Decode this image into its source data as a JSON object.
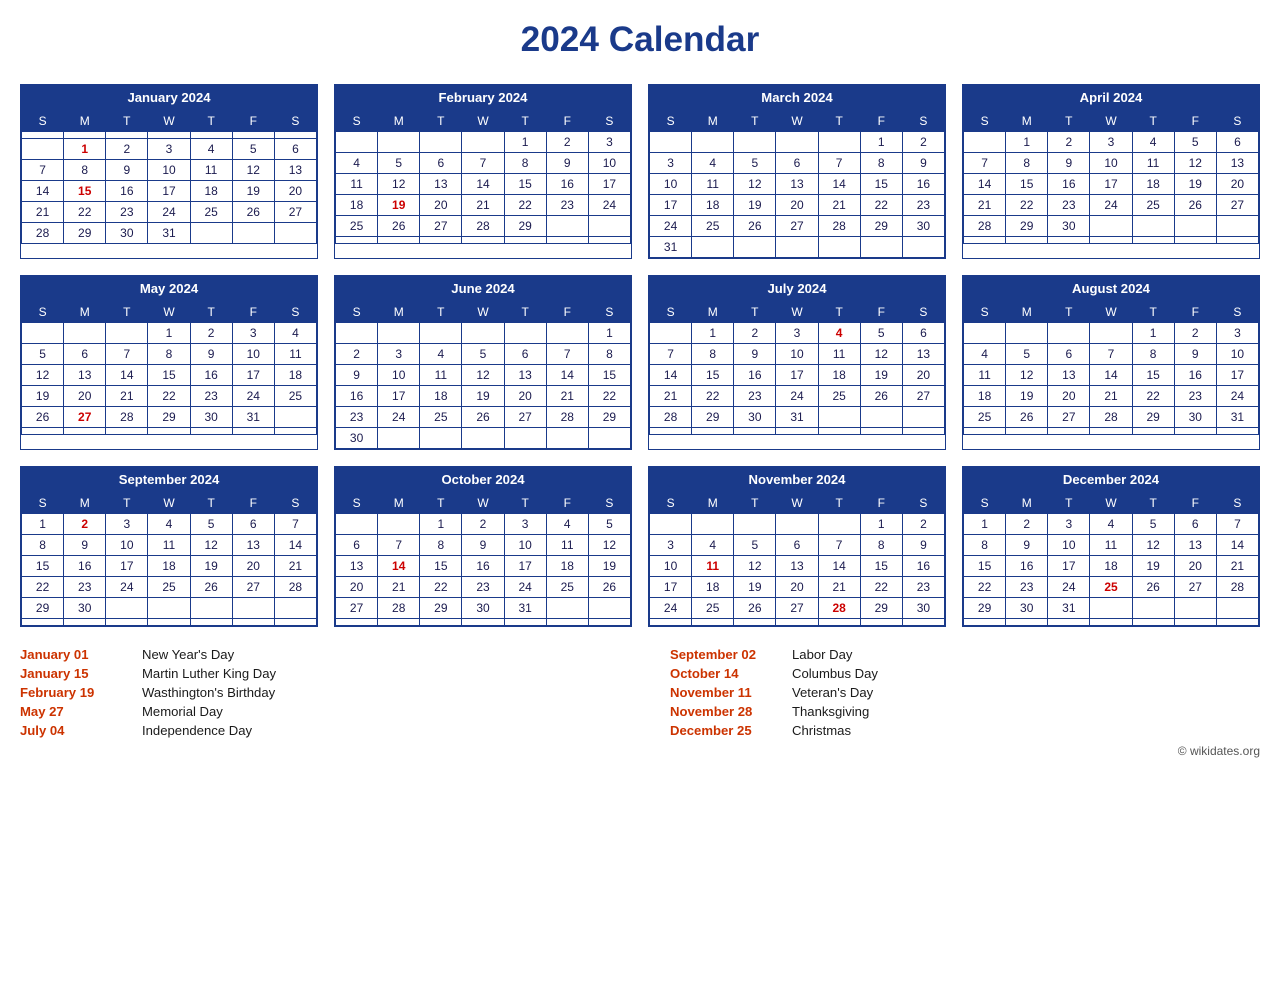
{
  "title": "2024 Calendar",
  "months": [
    {
      "name": "January 2024",
      "days": [
        [
          "",
          "",
          "",
          "",
          "",
          "",
          ""
        ],
        [
          "",
          "1",
          "2",
          "3",
          "4",
          "5",
          "6"
        ],
        [
          "7",
          "8",
          "9",
          "10",
          "11",
          "12",
          "13"
        ],
        [
          "14",
          "15",
          "16",
          "17",
          "18",
          "19",
          "20"
        ],
        [
          "21",
          "22",
          "23",
          "24",
          "25",
          "26",
          "27"
        ],
        [
          "28",
          "29",
          "30",
          "31",
          "",
          "",
          ""
        ]
      ],
      "holidays": [
        "1",
        "15"
      ]
    },
    {
      "name": "February 2024",
      "days": [
        [
          "",
          "",
          "",
          "",
          "1",
          "2",
          "3"
        ],
        [
          "4",
          "5",
          "6",
          "7",
          "8",
          "9",
          "10"
        ],
        [
          "11",
          "12",
          "13",
          "14",
          "15",
          "16",
          "17"
        ],
        [
          "18",
          "19",
          "20",
          "21",
          "22",
          "23",
          "24"
        ],
        [
          "25",
          "26",
          "27",
          "28",
          "29",
          "",
          ""
        ],
        [
          "",
          "",
          "",
          "",
          "",
          "",
          ""
        ]
      ],
      "holidays": [
        "19"
      ]
    },
    {
      "name": "March 2024",
      "days": [
        [
          "",
          "",
          "",
          "",
          "",
          "1",
          "2"
        ],
        [
          "3",
          "4",
          "5",
          "6",
          "7",
          "8",
          "9"
        ],
        [
          "10",
          "11",
          "12",
          "13",
          "14",
          "15",
          "16"
        ],
        [
          "17",
          "18",
          "19",
          "20",
          "21",
          "22",
          "23"
        ],
        [
          "24",
          "25",
          "26",
          "27",
          "28",
          "29",
          "30"
        ],
        [
          "31",
          "",
          "",
          "",
          "",
          "",
          ""
        ]
      ],
      "holidays": []
    },
    {
      "name": "April 2024",
      "days": [
        [
          "",
          "1",
          "2",
          "3",
          "4",
          "5",
          "6"
        ],
        [
          "7",
          "8",
          "9",
          "10",
          "11",
          "12",
          "13"
        ],
        [
          "14",
          "15",
          "16",
          "17",
          "18",
          "19",
          "20"
        ],
        [
          "21",
          "22",
          "23",
          "24",
          "25",
          "26",
          "27"
        ],
        [
          "28",
          "29",
          "30",
          "",
          "",
          "",
          ""
        ],
        [
          "",
          "",
          "",
          "",
          "",
          "",
          ""
        ]
      ],
      "holidays": []
    },
    {
      "name": "May 2024",
      "days": [
        [
          "",
          "",
          "",
          "1",
          "2",
          "3",
          "4"
        ],
        [
          "5",
          "6",
          "7",
          "8",
          "9",
          "10",
          "11"
        ],
        [
          "12",
          "13",
          "14",
          "15",
          "16",
          "17",
          "18"
        ],
        [
          "19",
          "20",
          "21",
          "22",
          "23",
          "24",
          "25"
        ],
        [
          "26",
          "27",
          "28",
          "29",
          "30",
          "31",
          ""
        ],
        [
          "",
          "",
          "",
          "",
          "",
          "",
          ""
        ]
      ],
      "holidays": [
        "27"
      ]
    },
    {
      "name": "June 2024",
      "days": [
        [
          "",
          "",
          "",
          "",
          "",
          "",
          "1"
        ],
        [
          "2",
          "3",
          "4",
          "5",
          "6",
          "7",
          "8"
        ],
        [
          "9",
          "10",
          "11",
          "12",
          "13",
          "14",
          "15"
        ],
        [
          "16",
          "17",
          "18",
          "19",
          "20",
          "21",
          "22"
        ],
        [
          "23",
          "24",
          "25",
          "26",
          "27",
          "28",
          "29"
        ],
        [
          "30",
          "",
          "",
          "",
          "",
          "",
          ""
        ]
      ],
      "holidays": []
    },
    {
      "name": "July 2024",
      "days": [
        [
          "",
          "1",
          "2",
          "3",
          "4",
          "5",
          "6"
        ],
        [
          "7",
          "8",
          "9",
          "10",
          "11",
          "12",
          "13"
        ],
        [
          "14",
          "15",
          "16",
          "17",
          "18",
          "19",
          "20"
        ],
        [
          "21",
          "22",
          "23",
          "24",
          "25",
          "26",
          "27"
        ],
        [
          "28",
          "29",
          "30",
          "31",
          "",
          "",
          ""
        ],
        [
          "",
          "",
          "",
          "",
          "",
          "",
          ""
        ]
      ],
      "holidays": [
        "4"
      ]
    },
    {
      "name": "August 2024",
      "days": [
        [
          "",
          "",
          "",
          "",
          "1",
          "2",
          "3"
        ],
        [
          "4",
          "5",
          "6",
          "7",
          "8",
          "9",
          "10"
        ],
        [
          "11",
          "12",
          "13",
          "14",
          "15",
          "16",
          "17"
        ],
        [
          "18",
          "19",
          "20",
          "21",
          "22",
          "23",
          "24"
        ],
        [
          "25",
          "26",
          "27",
          "28",
          "29",
          "30",
          "31"
        ],
        [
          "",
          "",
          "",
          "",
          "",
          "",
          ""
        ]
      ],
      "holidays": []
    },
    {
      "name": "September 2024",
      "days": [
        [
          "1",
          "2",
          "3",
          "4",
          "5",
          "6",
          "7"
        ],
        [
          "8",
          "9",
          "10",
          "11",
          "12",
          "13",
          "14"
        ],
        [
          "15",
          "16",
          "17",
          "18",
          "19",
          "20",
          "21"
        ],
        [
          "22",
          "23",
          "24",
          "25",
          "26",
          "27",
          "28"
        ],
        [
          "29",
          "30",
          "",
          "",
          "",
          "",
          ""
        ],
        [
          "",
          "",
          "",
          "",
          "",
          "",
          ""
        ]
      ],
      "holidays": [
        "2"
      ]
    },
    {
      "name": "October 2024",
      "days": [
        [
          "",
          "",
          "1",
          "2",
          "3",
          "4",
          "5"
        ],
        [
          "6",
          "7",
          "8",
          "9",
          "10",
          "11",
          "12"
        ],
        [
          "13",
          "14",
          "15",
          "16",
          "17",
          "18",
          "19"
        ],
        [
          "20",
          "21",
          "22",
          "23",
          "24",
          "25",
          "26"
        ],
        [
          "27",
          "28",
          "29",
          "30",
          "31",
          "",
          ""
        ],
        [
          "",
          "",
          "",
          "",
          "",
          "",
          ""
        ]
      ],
      "holidays": [
        "14"
      ]
    },
    {
      "name": "November 2024",
      "days": [
        [
          "",
          "",
          "",
          "",
          "",
          "1",
          "2"
        ],
        [
          "3",
          "4",
          "5",
          "6",
          "7",
          "8",
          "9"
        ],
        [
          "10",
          "11",
          "12",
          "13",
          "14",
          "15",
          "16"
        ],
        [
          "17",
          "18",
          "19",
          "20",
          "21",
          "22",
          "23"
        ],
        [
          "24",
          "25",
          "26",
          "27",
          "28",
          "29",
          "30"
        ],
        [
          "",
          "",
          "",
          "",
          "",
          "",
          ""
        ]
      ],
      "holidays": [
        "11",
        "28"
      ]
    },
    {
      "name": "December 2024",
      "days": [
        [
          "1",
          "2",
          "3",
          "4",
          "5",
          "6",
          "7"
        ],
        [
          "8",
          "9",
          "10",
          "11",
          "12",
          "13",
          "14"
        ],
        [
          "15",
          "16",
          "17",
          "18",
          "19",
          "20",
          "21"
        ],
        [
          "22",
          "23",
          "24",
          "25",
          "26",
          "27",
          "28"
        ],
        [
          "29",
          "30",
          "31",
          "",
          "",
          "",
          ""
        ],
        [
          "",
          "",
          "",
          "",
          "",
          "",
          ""
        ]
      ],
      "holidays": [
        "25"
      ]
    }
  ],
  "weekdays": [
    "S",
    "M",
    "T",
    "W",
    "T",
    "F",
    "S"
  ],
  "holidays_list": [
    {
      "date": "January 01",
      "name": "New Year's Day"
    },
    {
      "date": "January 15",
      "name": "Martin Luther King Day"
    },
    {
      "date": "February 19",
      "name": "Wasthington's Birthday"
    },
    {
      "date": "May 27",
      "name": "Memorial Day"
    },
    {
      "date": "July 04",
      "name": "Independence Day"
    },
    {
      "date": "September 02",
      "name": "Labor Day"
    },
    {
      "date": "October 14",
      "name": "Columbus Day"
    },
    {
      "date": "November 11",
      "name": "Veteran's Day"
    },
    {
      "date": "November 28",
      "name": "Thanksgiving"
    },
    {
      "date": "December 25",
      "name": "Christmas"
    }
  ],
  "footer": "© wikidates.org"
}
